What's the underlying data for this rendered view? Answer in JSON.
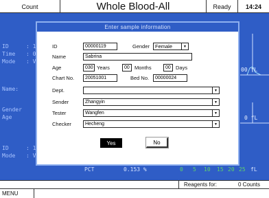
{
  "topbar": {
    "count": "Count",
    "title": "Whole Blood-All",
    "status": "Ready",
    "time": "14:24"
  },
  "background": {
    "id_label": "ID",
    "id_val": ": 1",
    "time_label": "Time",
    "time_val": ": 0",
    "mode_label": "Mode",
    "mode_val": ": V",
    "name_label": "Name:",
    "gender_label": "Gender",
    "age_label": "Age",
    "id2_label": "ID",
    "id2_val": ": 1",
    "mode2_label": "Mode",
    "mode2_val": ": V",
    "fl1": "00 fL",
    "fl2": "0 fL",
    "pct_label": "PCT",
    "pct_value": "0.153 %",
    "axis": [
      "0",
      "5",
      "10",
      "15",
      "20",
      "25",
      "fL"
    ]
  },
  "status": {
    "reagents": "Reagents for:",
    "counts": "0 Counts"
  },
  "menu": {
    "label": "MENU"
  },
  "dialog": {
    "title": "Enter sample information",
    "id_label": "ID",
    "id_value": "00000119",
    "gender_label": "Gender",
    "gender_value": "Female",
    "name_label": "Name",
    "name_value": "Sabrina",
    "age_label": "Age",
    "age_years": "030",
    "years_unit": "Years",
    "age_months": "00",
    "months_unit": "Months",
    "age_days": "00",
    "days_unit": "Days",
    "chart_label": "Chart No.",
    "chart_value": "20051001",
    "bed_label": "Bed No.",
    "bed_value": "00000024",
    "dept_label": "Dept.",
    "dept_value": "",
    "sender_label": "Sender",
    "sender_value": "Zhangyin",
    "tester_label": "Tester",
    "tester_value": "Wangfen",
    "checker_label": "Checker",
    "checker_value": "Hecheng",
    "yes_label": "Yes",
    "no_label": "No"
  }
}
